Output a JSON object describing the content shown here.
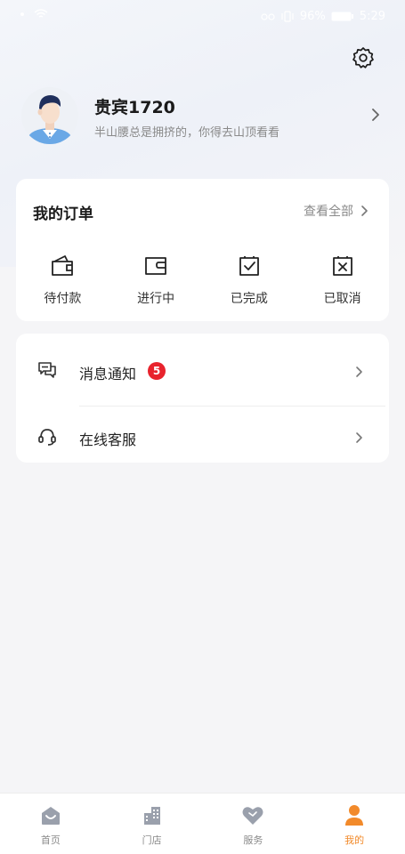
{
  "status_bar": {
    "battery": "96%",
    "time": "5:29"
  },
  "profile": {
    "name": "贵宾1720",
    "subtitle": "半山腰总是拥挤的，你得去山顶看看"
  },
  "orders": {
    "title": "我的订单",
    "view_all": "查看全部",
    "items": [
      {
        "label": "待付款",
        "icon": "wallet-icon"
      },
      {
        "label": "进行中",
        "icon": "in-progress-icon"
      },
      {
        "label": "已完成",
        "icon": "check-box-icon"
      },
      {
        "label": "已取消",
        "icon": "cancel-box-icon"
      }
    ]
  },
  "menu": {
    "items": [
      {
        "label": "消息通知",
        "badge": "5",
        "icon": "message-icon"
      },
      {
        "label": "在线客服",
        "icon": "headset-icon"
      }
    ]
  },
  "tabbar": {
    "items": [
      {
        "label": "首页",
        "icon": "home-icon"
      },
      {
        "label": "门店",
        "icon": "store-icon"
      },
      {
        "label": "服务",
        "icon": "heart-icon"
      },
      {
        "label": "我的",
        "icon": "user-icon"
      }
    ],
    "active_index": 3
  },
  "colors": {
    "accent": "#f28a2a",
    "badge": "#e8232d",
    "tab_inactive": "#9aa0ac"
  }
}
